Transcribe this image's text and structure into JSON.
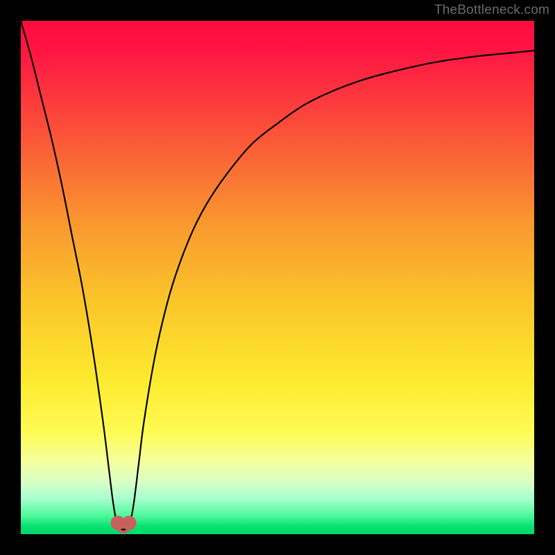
{
  "watermark": "TheBottleneck.com",
  "chart_data": {
    "type": "line",
    "title": "",
    "xlabel": "",
    "ylabel": "",
    "xlim": [
      0,
      100
    ],
    "ylim": [
      0,
      100
    ],
    "background": {
      "gradient_stops": [
        {
          "pos": 0.0,
          "color": "#ff0b3f"
        },
        {
          "pos": 0.06,
          "color": "#ff1643"
        },
        {
          "pos": 0.2,
          "color": "#fb4b3a"
        },
        {
          "pos": 0.4,
          "color": "#f99a2e"
        },
        {
          "pos": 0.55,
          "color": "#fbc62a"
        },
        {
          "pos": 0.7,
          "color": "#fdea2f"
        },
        {
          "pos": 0.8,
          "color": "#fefb52"
        },
        {
          "pos": 0.86,
          "color": "#f4ffa0"
        },
        {
          "pos": 0.9,
          "color": "#d7ffc6"
        },
        {
          "pos": 0.93,
          "color": "#a8ffce"
        },
        {
          "pos": 0.965,
          "color": "#4cf79b"
        },
        {
          "pos": 0.985,
          "color": "#06e070"
        },
        {
          "pos": 1.0,
          "color": "#02d968"
        }
      ]
    },
    "series": [
      {
        "name": "bottleneck-curve",
        "color": "#000000",
        "stroke_width": 2.2,
        "x": [
          0,
          2,
          4,
          6,
          8,
          10,
          12,
          14,
          16,
          17,
          18,
          18.8,
          19.6,
          20.4,
          21.2,
          22,
          23,
          24,
          26,
          28,
          30,
          33,
          36,
          40,
          45,
          50,
          55,
          60,
          66,
          72,
          80,
          88,
          96,
          100
        ],
        "y": [
          100,
          93,
          85,
          77,
          68,
          58,
          48,
          36,
          22,
          14,
          6,
          2,
          1,
          1,
          2,
          6,
          14,
          22,
          34,
          43,
          50,
          58,
          64,
          70,
          76,
          80,
          83.5,
          86,
          88.3,
          90,
          91.8,
          93,
          93.8,
          94.2
        ]
      }
    ],
    "markers": [
      {
        "name": "min-marker-left",
        "x": 18.9,
        "y": 2.2,
        "r": 1.4,
        "color": "#c9605e"
      },
      {
        "name": "min-marker-right",
        "x": 21.1,
        "y": 2.2,
        "r": 1.4,
        "color": "#c9605e"
      }
    ],
    "min_segment": {
      "color": "#c9605e",
      "stroke_width": 9,
      "x": [
        18.9,
        19.4,
        20.0,
        20.6,
        21.1
      ],
      "y": [
        2.2,
        1.0,
        0.8,
        1.0,
        2.2
      ]
    }
  }
}
